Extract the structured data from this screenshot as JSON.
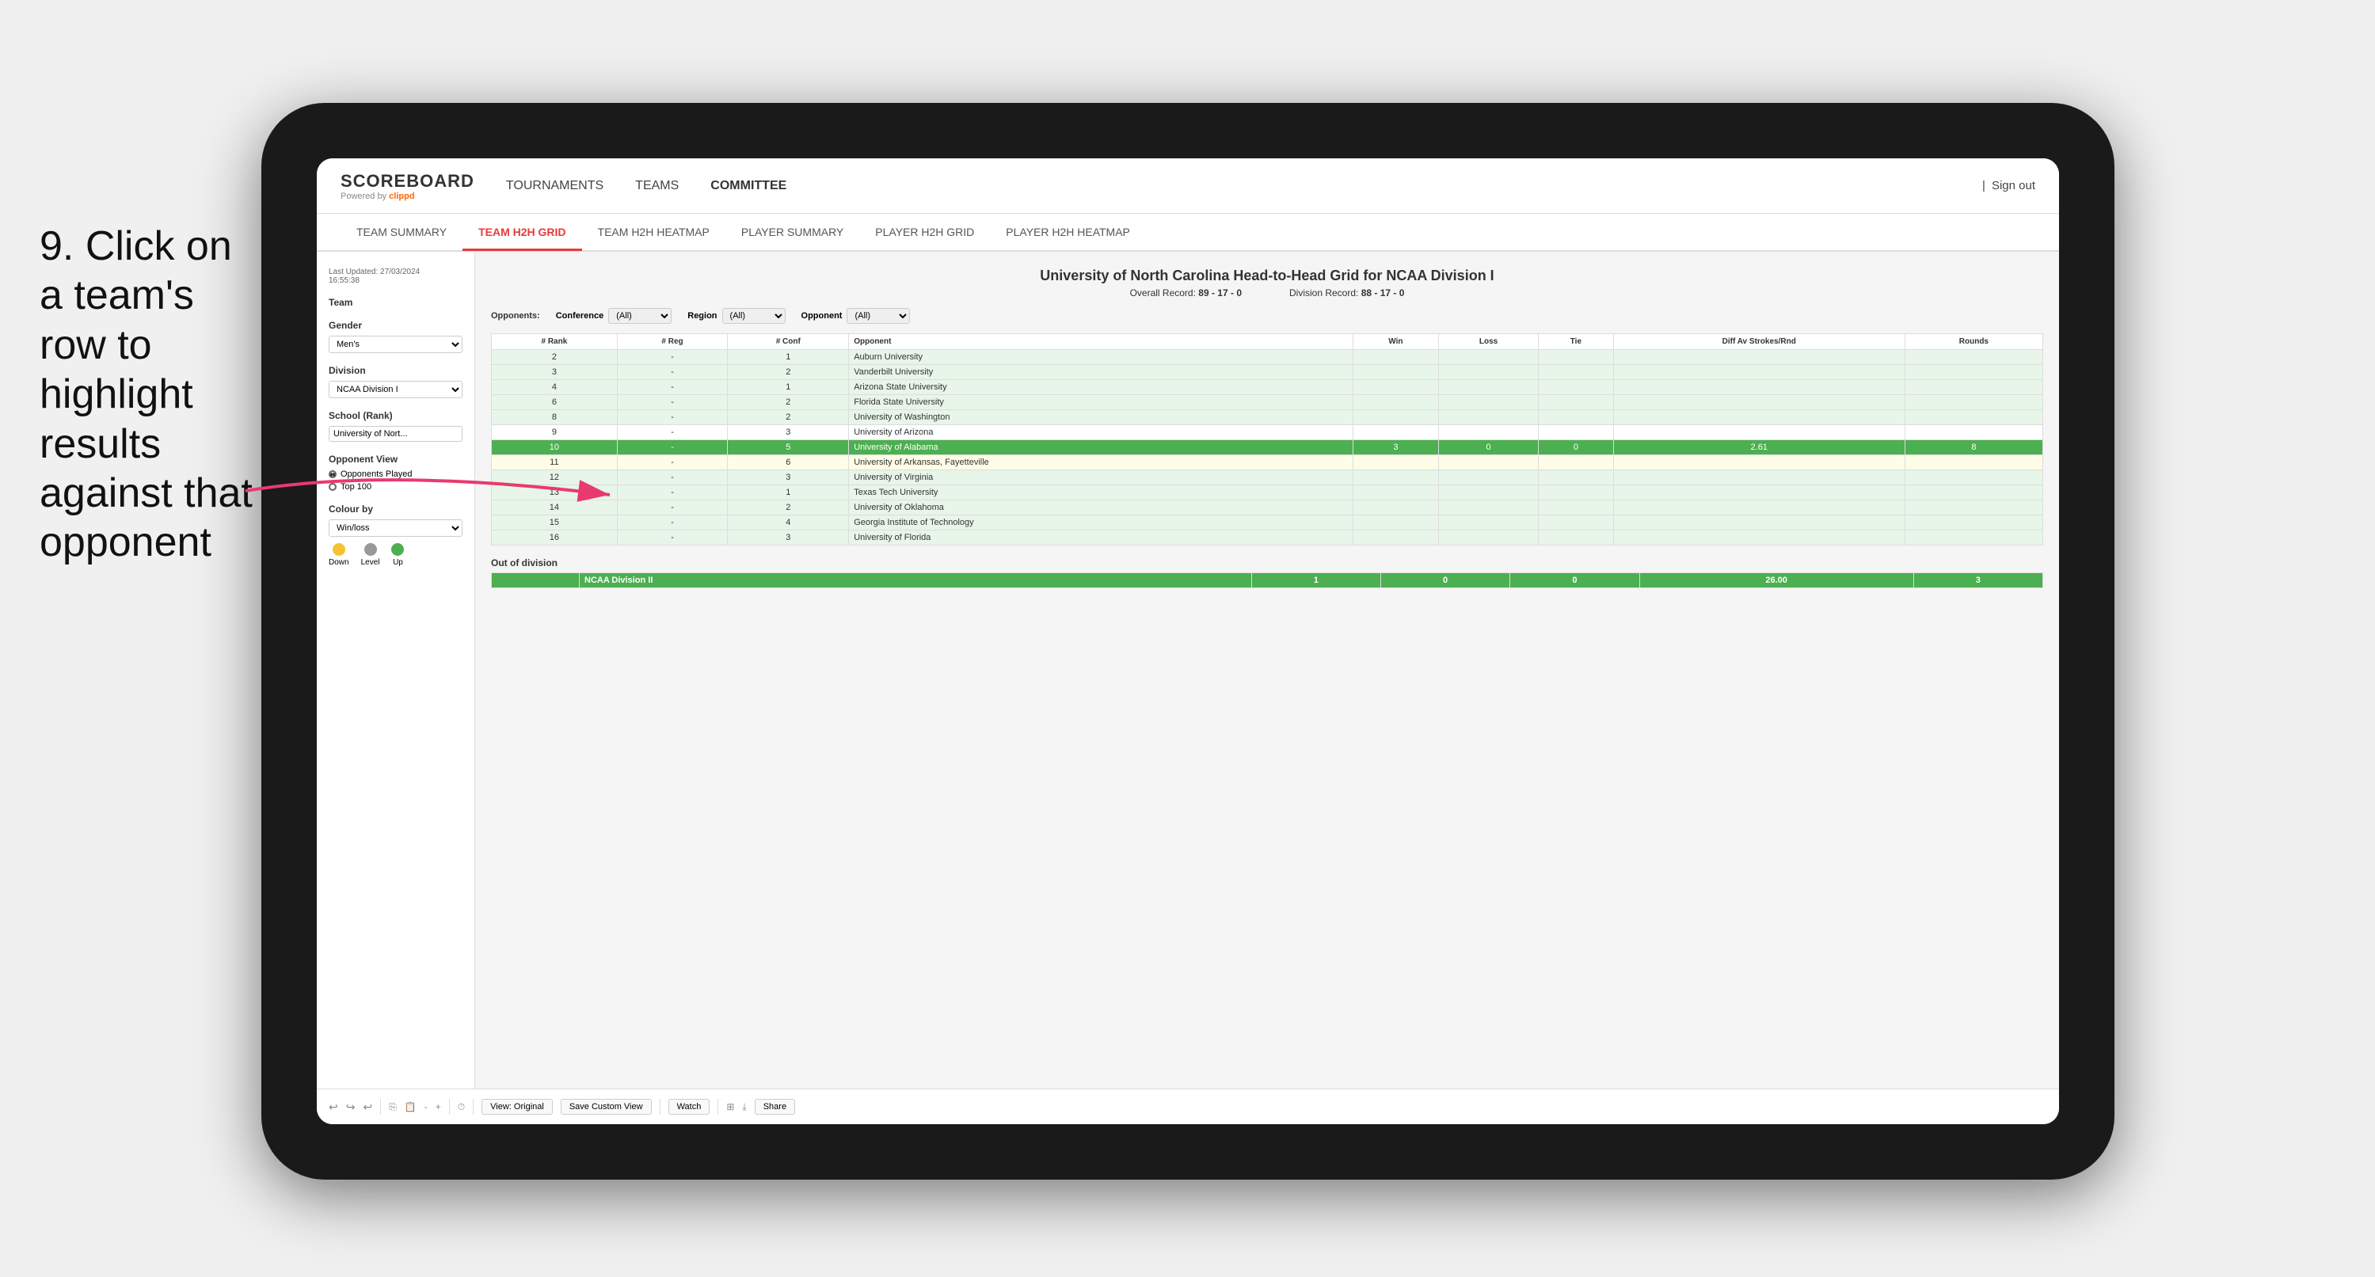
{
  "instruction": {
    "number": "9.",
    "text": "Click on a team's row to highlight results against that opponent"
  },
  "nav": {
    "logo": "SCOREBOARD",
    "powered_by": "Powered by",
    "brand": "clippd",
    "items": [
      "TOURNAMENTS",
      "TEAMS",
      "COMMITTEE"
    ],
    "sign_out": "Sign out"
  },
  "sub_nav": {
    "items": [
      "TEAM SUMMARY",
      "TEAM H2H GRID",
      "TEAM H2H HEATMAP",
      "PLAYER SUMMARY",
      "PLAYER H2H GRID",
      "PLAYER H2H HEATMAP"
    ],
    "active": "TEAM H2H GRID"
  },
  "left_panel": {
    "timestamp_label": "Last Updated: 27/03/2024",
    "timestamp_time": "16:55:38",
    "team_label": "Team",
    "gender_label": "Gender",
    "gender_value": "Men's",
    "division_label": "Division",
    "division_value": "NCAA Division I",
    "school_label": "School (Rank)",
    "school_value": "University of Nort...",
    "opponent_view_label": "Opponent View",
    "radio_opponents": "Opponents Played",
    "radio_top100": "Top 100",
    "colour_label": "Colour by",
    "colour_value": "Win/loss",
    "legend_down": "Down",
    "legend_level": "Level",
    "legend_up": "Up"
  },
  "grid": {
    "title": "University of North Carolina Head-to-Head Grid for NCAA Division I",
    "overall_record_label": "Overall Record:",
    "overall_record": "89 - 17 - 0",
    "division_record_label": "Division Record:",
    "division_record": "88 - 17 - 0",
    "filters": {
      "opponents_label": "Opponents:",
      "conference_label": "Conference",
      "conference_value": "(All)",
      "region_label": "Region",
      "region_value": "(All)",
      "opponent_label": "Opponent",
      "opponent_value": "(All)"
    },
    "columns": [
      "# Rank",
      "# Reg",
      "# Conf",
      "Opponent",
      "Win",
      "Loss",
      "Tie",
      "Diff Av Strokes/Rnd",
      "Rounds"
    ],
    "rows": [
      {
        "rank": "2",
        "reg": "-",
        "conf": "1",
        "opponent": "Auburn University",
        "win": "",
        "loss": "",
        "tie": "",
        "diff": "",
        "rounds": "",
        "color": "light-green"
      },
      {
        "rank": "3",
        "reg": "-",
        "conf": "2",
        "opponent": "Vanderbilt University",
        "win": "",
        "loss": "",
        "tie": "",
        "diff": "",
        "rounds": "",
        "color": "light-green"
      },
      {
        "rank": "4",
        "reg": "-",
        "conf": "1",
        "opponent": "Arizona State University",
        "win": "",
        "loss": "",
        "tie": "",
        "diff": "",
        "rounds": "",
        "color": "light-green"
      },
      {
        "rank": "6",
        "reg": "-",
        "conf": "2",
        "opponent": "Florida State University",
        "win": "",
        "loss": "",
        "tie": "",
        "diff": "",
        "rounds": "",
        "color": "light-green"
      },
      {
        "rank": "8",
        "reg": "-",
        "conf": "2",
        "opponent": "University of Washington",
        "win": "",
        "loss": "",
        "tie": "",
        "diff": "",
        "rounds": "",
        "color": "light-green"
      },
      {
        "rank": "9",
        "reg": "-",
        "conf": "3",
        "opponent": "University of Arizona",
        "win": "",
        "loss": "",
        "tie": "",
        "diff": "",
        "rounds": "",
        "color": "white"
      },
      {
        "rank": "10",
        "reg": "-",
        "conf": "5",
        "opponent": "University of Alabama",
        "win": "3",
        "loss": "0",
        "tie": "0",
        "diff": "2.61",
        "rounds": "8",
        "color": "highlighted"
      },
      {
        "rank": "11",
        "reg": "-",
        "conf": "6",
        "opponent": "University of Arkansas, Fayetteville",
        "win": "",
        "loss": "",
        "tie": "",
        "diff": "",
        "rounds": "",
        "color": "light-yellow"
      },
      {
        "rank": "12",
        "reg": "-",
        "conf": "3",
        "opponent": "University of Virginia",
        "win": "",
        "loss": "",
        "tie": "",
        "diff": "",
        "rounds": "",
        "color": "light-green"
      },
      {
        "rank": "13",
        "reg": "-",
        "conf": "1",
        "opponent": "Texas Tech University",
        "win": "",
        "loss": "",
        "tie": "",
        "diff": "",
        "rounds": "",
        "color": "light-green"
      },
      {
        "rank": "14",
        "reg": "-",
        "conf": "2",
        "opponent": "University of Oklahoma",
        "win": "",
        "loss": "",
        "tie": "",
        "diff": "",
        "rounds": "",
        "color": "light-green"
      },
      {
        "rank": "15",
        "reg": "-",
        "conf": "4",
        "opponent": "Georgia Institute of Technology",
        "win": "",
        "loss": "",
        "tie": "",
        "diff": "",
        "rounds": "",
        "color": "light-green"
      },
      {
        "rank": "16",
        "reg": "-",
        "conf": "3",
        "opponent": "University of Florida",
        "win": "",
        "loss": "",
        "tie": "",
        "diff": "",
        "rounds": "",
        "color": "light-green"
      }
    ],
    "out_of_division_label": "Out of division",
    "out_division_row": {
      "label": "NCAA Division II",
      "win": "1",
      "loss": "0",
      "tie": "0",
      "diff": "26.00",
      "rounds": "3"
    }
  },
  "toolbar": {
    "view_label": "View: Original",
    "save_label": "Save Custom View",
    "watch_label": "Watch",
    "share_label": "Share"
  }
}
